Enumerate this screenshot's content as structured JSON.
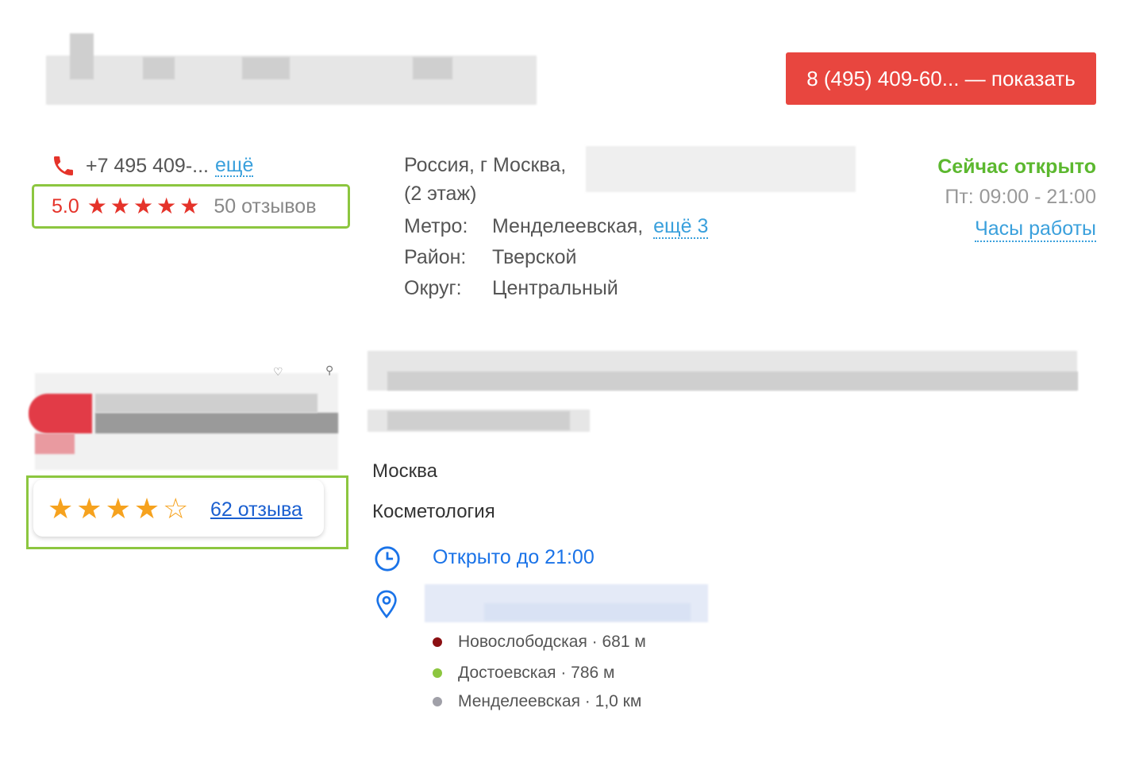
{
  "header": {
    "phone_button_label": "8 (495) 409-60... — показать"
  },
  "listing1": {
    "phone_text": "+7 495 409-...",
    "phone_more": "ещё",
    "rating_value": "5.0",
    "rating_stars": 5,
    "reviews": "50 отзывов",
    "address_line1": "Россия, г Москва,",
    "address_line2": "(2 этаж)",
    "metro_label": "Метро:",
    "metro_value": "Менделеевская,",
    "metro_more": "ещё 3",
    "district_label": "Район:",
    "district_value": "Тверской",
    "okrug_label": "Округ:",
    "okrug_value": "Центральный",
    "open_now": "Сейчас открыто",
    "hours": "Пт: 09:00 - 21:00",
    "hours_link": "Часы работы"
  },
  "listing2": {
    "rating_stars": 4.5,
    "reviews_link": "62 отзыва",
    "city": "Москва",
    "category": "Косметология",
    "open_until": "Открыто до 21:00",
    "metro": [
      {
        "name": "Новослободская · 681 м",
        "color": "#8b0f12"
      },
      {
        "name": "Достоевская · 786 м",
        "color": "#8cc63f"
      },
      {
        "name": "Менделеевская · 1,0 км",
        "color": "#a0a0a8"
      }
    ]
  },
  "colors": {
    "accent_red": "#e8463f",
    "highlight_green": "#8cc63f",
    "link_blue": "#3aa0dc",
    "google_blue": "#1a73e8",
    "star_gold": "#f6a21e"
  }
}
